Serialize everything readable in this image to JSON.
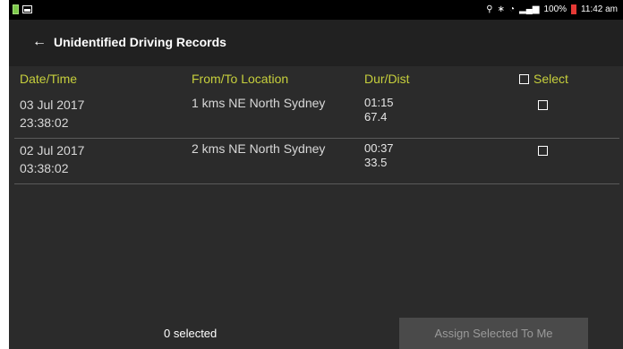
{
  "status_bar": {
    "battery_percent": "100%",
    "time": "11:42 am"
  },
  "app_bar": {
    "back_icon": "arrow-left-icon",
    "title": "Unidentified Driving Records"
  },
  "table": {
    "columns": [
      "Date/Time",
      "From/To Location",
      "Dur/Dist",
      "Select"
    ],
    "rows": [
      {
        "date": "03 Jul 2017",
        "time": "23:38:02",
        "location": "1 kms NE North Sydney",
        "duration": "01:15",
        "distance": "67.4",
        "selected": false
      },
      {
        "date": "02 Jul 2017",
        "time": "03:38:02",
        "location": "2 kms NE North Sydney",
        "duration": "00:37",
        "distance": "33.5",
        "selected": false
      }
    ]
  },
  "footer": {
    "selected_count": "0 selected",
    "assign_button": "Assign Selected To Me"
  },
  "colors": {
    "header_accent": "#c6cf3c",
    "background": "#2b2b2b",
    "app_bar": "#212121"
  }
}
